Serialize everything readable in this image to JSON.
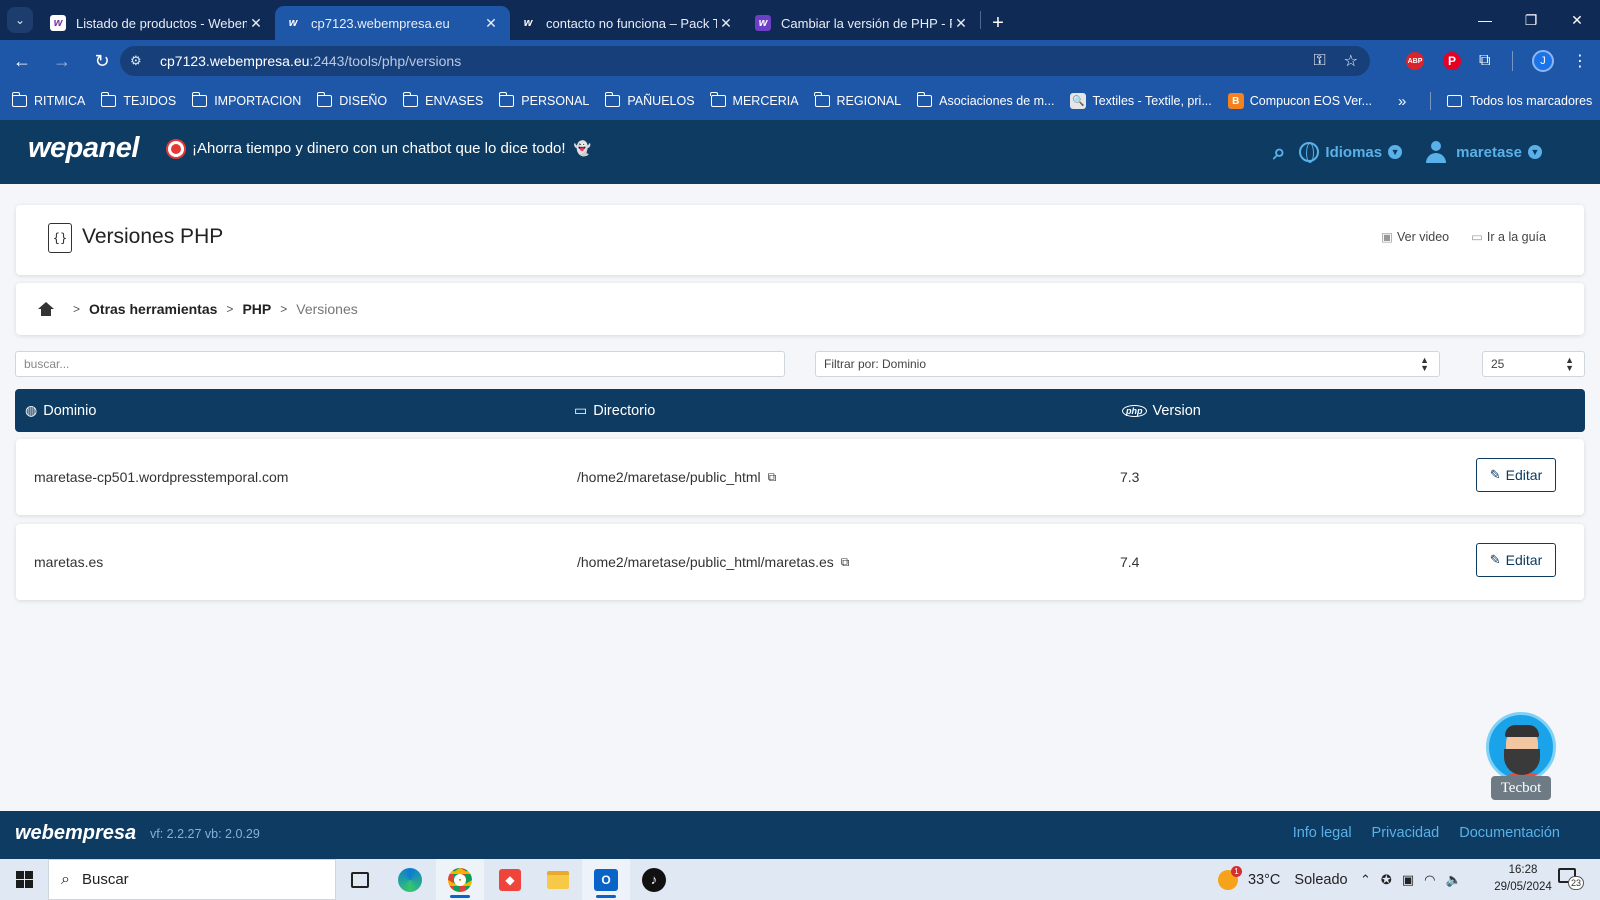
{
  "browser": {
    "tabs": [
      {
        "title": "Listado de productos - Webemp",
        "favicon": "webempresa-w-icon",
        "active": false
      },
      {
        "title": "cp7123.webempresa.eu",
        "favicon": "wepanel-w-icon",
        "active": true
      },
      {
        "title": "contacto no funciona – Pack Tie",
        "favicon": "webempresa-w-icon",
        "active": false
      },
      {
        "title": "Cambiar la versión de PHP - Pre",
        "favicon": "webempresa-w-icon",
        "active": false
      }
    ],
    "url_host": "cp7123.webempresa.eu",
    "url_path": ":2443/tools/php/versions",
    "profile_initial": "J",
    "bookmarks": [
      {
        "label": "RITMICA",
        "type": "folder"
      },
      {
        "label": "TEJIDOS",
        "type": "folder"
      },
      {
        "label": "IMPORTACION",
        "type": "folder"
      },
      {
        "label": "DISEÑO",
        "type": "folder"
      },
      {
        "label": "ENVASES",
        "type": "folder"
      },
      {
        "label": "PERSONAL",
        "type": "folder"
      },
      {
        "label": "PAÑUELOS",
        "type": "folder"
      },
      {
        "label": "MERCERIA",
        "type": "folder"
      },
      {
        "label": "REGIONAL",
        "type": "folder"
      },
      {
        "label": "Asociaciones de m...",
        "type": "folder"
      },
      {
        "label": "Textiles - Textile, pri...",
        "type": "site"
      },
      {
        "label": "Compucon EOS Ver...",
        "type": "site"
      }
    ],
    "all_bookmarks_label": "Todos los marcadores"
  },
  "header": {
    "logo": "wepanel",
    "promo": "¡Ahorra tiempo y dinero con un chatbot que lo dice todo!",
    "languages_label": "Idiomas",
    "username": "maretase",
    "accent_color": "#5ab0e8",
    "bg_color": "#0d3b62"
  },
  "page": {
    "title": "Versiones PHP",
    "video_link": "Ver video",
    "guide_link": "Ir a la guía",
    "breadcrumb": [
      "Otras herramientas",
      "PHP",
      "Versiones"
    ]
  },
  "filters": {
    "search_placeholder": "buscar...",
    "filter_value": "Filtrar por: Dominio",
    "page_size": "25"
  },
  "table": {
    "columns": [
      "Dominio",
      "Directorio",
      "Version"
    ],
    "rows": [
      {
        "domain": "maretase-cp501.wordpresstemporal.com",
        "directory": "/home2/maretase/public_html",
        "version": "7.3",
        "action": "Editar"
      },
      {
        "domain": "maretas.es",
        "directory": "/home2/maretase/public_html/maretas.es",
        "version": "7.4",
        "action": "Editar"
      }
    ]
  },
  "chatbot": {
    "label": "Tecbot"
  },
  "footer": {
    "logo": "webempresa",
    "version": "vf: 2.2.27 vb: 2.0.29",
    "links": [
      "Info legal",
      "Privacidad",
      "Documentación"
    ]
  },
  "taskbar": {
    "search_label": "Buscar",
    "temperature": "33°C",
    "weather": "Soleado",
    "weather_badge": "1",
    "time": "16:28",
    "date": "29/05/2024",
    "notifications": "23"
  }
}
